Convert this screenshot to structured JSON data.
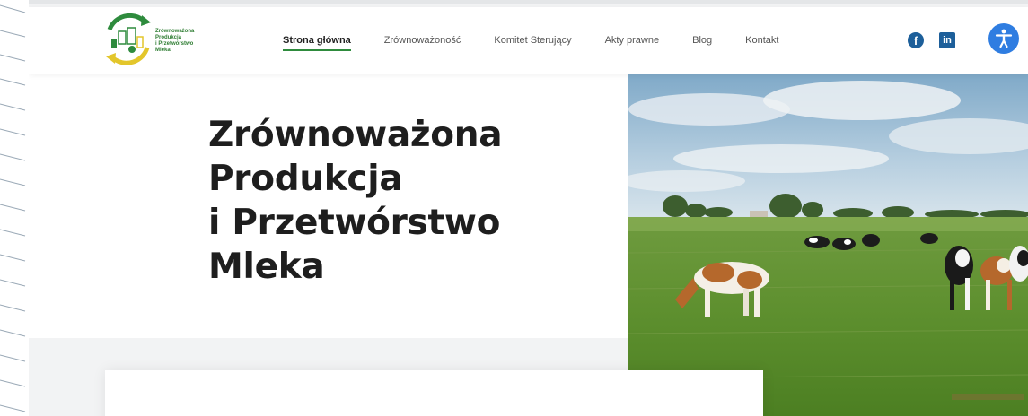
{
  "logo": {
    "lines": [
      "Zrównoważona",
      "Produkcja",
      "i Przetwórstwo",
      "Mleka"
    ],
    "icon": "dairy-cycle-logo-icon"
  },
  "nav": {
    "items": [
      {
        "label": "Strona główna",
        "active": true
      },
      {
        "label": "Zrównoważoność",
        "active": false
      },
      {
        "label": "Komitet Sterujący",
        "active": false
      },
      {
        "label": "Akty prawne",
        "active": false
      },
      {
        "label": "Blog",
        "active": false
      },
      {
        "label": "Kontakt",
        "active": false
      }
    ]
  },
  "social": {
    "facebook": {
      "icon": "facebook-icon",
      "glyph": "f"
    },
    "linkedin": {
      "icon": "linkedin-icon",
      "glyph": "in"
    },
    "accessibility": {
      "icon": "accessibility-icon"
    }
  },
  "hero": {
    "title_lines": [
      "Zrównoważona",
      "Produkcja",
      "i Przetwórstwo",
      "Mleka"
    ],
    "image": "cows-grazing-pasture-photo"
  },
  "colors": {
    "accent_green": "#2e8b3d",
    "social_blue": "#1d5f9a",
    "accessibility_blue": "#2f7de1"
  }
}
